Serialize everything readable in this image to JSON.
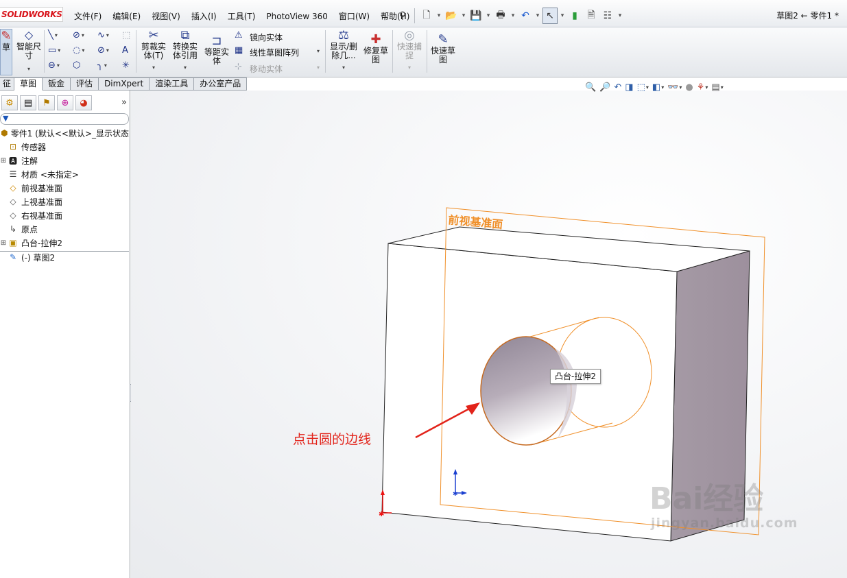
{
  "app": {
    "logo": "SOLIDWORKS",
    "document_title": "草图2 ← 零件1 *",
    "menus": [
      "文件(F)",
      "编辑(E)",
      "视图(V)",
      "插入(I)",
      "工具(T)",
      "PhotoView 360",
      "窗口(W)",
      "帮助(H)"
    ]
  },
  "quick_access": {
    "icons": [
      "pin-icon",
      "new-icon",
      "open-icon",
      "save-icon",
      "print-icon",
      "undo-icon",
      "select-icon",
      "rebuild-icon",
      "file-properties-icon",
      "options-icon"
    ]
  },
  "ribbon": {
    "sketch_label": "草",
    "smart_dimension": "智能尺寸",
    "trim": "剪裁实体(T)",
    "convert": "转换实体引用",
    "offset": "等距实体",
    "mirror": "镜向实体",
    "linear_pattern": "线性草图阵列",
    "move": "移动实体",
    "display_delete": "显示/删除几...",
    "repair": "修复草图",
    "quick_snap": "快速捕捉",
    "rapid_sketch": "快速草图"
  },
  "tabs": [
    "征",
    "草图",
    "钣金",
    "评估",
    "DimXpert",
    "渲染工具",
    "办公室产品"
  ],
  "active_tab": "草图",
  "tree": {
    "root": "零件1  (默认<<默认>_显示状态",
    "items": [
      {
        "label": "传感器",
        "icon": "sensor-icon",
        "expandable": false
      },
      {
        "label": "注解",
        "icon": "annotation-icon",
        "expandable": true
      },
      {
        "label": "材质 <未指定>",
        "icon": "material-icon",
        "expandable": false
      },
      {
        "label": "前视基准面",
        "icon": "plane-icon",
        "expandable": false
      },
      {
        "label": "上视基准面",
        "icon": "plane-icon",
        "expandable": false
      },
      {
        "label": "右视基准面",
        "icon": "plane-icon",
        "expandable": false
      },
      {
        "label": "原点",
        "icon": "origin-icon",
        "expandable": false
      },
      {
        "label": "凸台-拉伸2",
        "icon": "extrude-icon",
        "expandable": true
      },
      {
        "label": "(-) 草图2",
        "icon": "sketch-icon",
        "expandable": false
      }
    ]
  },
  "viewport": {
    "plane_label": "前视基准面",
    "tooltip": "凸台-拉伸2",
    "annotation": "点击圆的边线",
    "watermark_main": "Bai经验",
    "watermark_sub": "jingyan.baidu.com"
  },
  "colors": {
    "plane": "#f0902a",
    "annotation": "#e2231a",
    "side_face": "#a89aa7",
    "logo": "#d8141b"
  }
}
